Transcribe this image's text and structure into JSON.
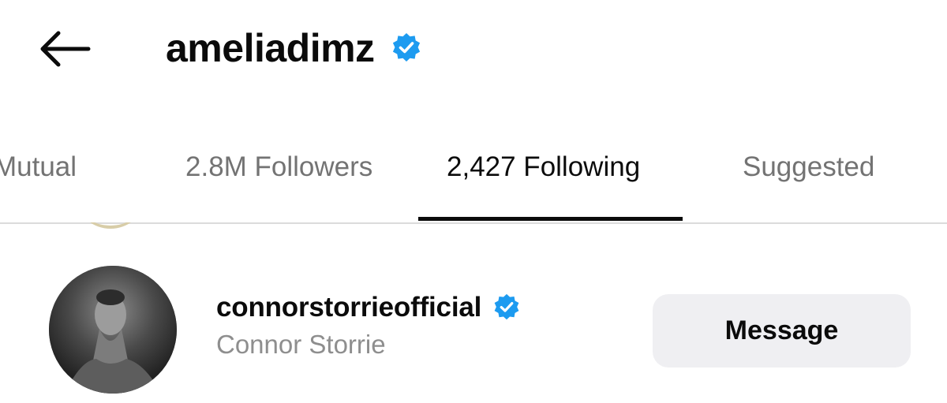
{
  "header": {
    "username": "ameliadimz",
    "verified": true
  },
  "tabs": [
    {
      "label": "Mutual",
      "active": false
    },
    {
      "label": "2.8M Followers",
      "active": false
    },
    {
      "label": "2,427 Following",
      "active": true
    },
    {
      "label": "Suggested",
      "active": false
    }
  ],
  "list": [
    {
      "username": "connorstorrieofficial",
      "full_name": "Connor Storrie",
      "verified": true,
      "action_label": "Message"
    }
  ],
  "colors": {
    "verified_blue": "#1d9bf0",
    "active_tab": "#0b0b0b",
    "inactive_tab": "#737373",
    "secondary_text": "#8e8e8e",
    "button_bg": "#efeff2"
  }
}
